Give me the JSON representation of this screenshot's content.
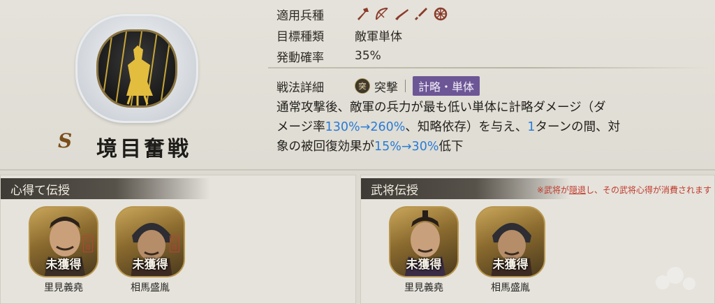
{
  "skill": {
    "rank": "S",
    "name": "境目奮戦",
    "emblem": "golden-warrior-emblem-icon"
  },
  "info": {
    "troop_label": "適用兵種",
    "troop_icons": [
      "spear-icon",
      "bow-icon",
      "gun-icon",
      "sword-icon",
      "wheel-icon"
    ],
    "target_label": "目標種類",
    "target_value": "敵軍単体",
    "rate_label": "発動確率",
    "rate_value": "35%"
  },
  "detail": {
    "label": "戦法詳細",
    "attack_icon_char": "突",
    "attack_type": "突撃",
    "tag": "計略・単体",
    "text_1": "通常攻撃後、敵軍の兵力が最も低い単体に計略ダメージ（ダ",
    "text_2a": "メージ率",
    "text_2b": "130%→260%",
    "text_2c": "、知略依存）を与え、",
    "text_2d": "1",
    "text_2e": "ターンの間、対",
    "text_3a": "象の被回復効果が",
    "text_3b": "15%→30%",
    "text_3c": "低下"
  },
  "left_panel": {
    "title": "心得て伝授",
    "cards": [
      {
        "status": "未獲得",
        "name": "里見義堯",
        "stamp": "心得"
      },
      {
        "status": "未獲得",
        "name": "相馬盛胤",
        "stamp": "心得"
      }
    ]
  },
  "right_panel": {
    "title": "武将伝授",
    "notice_a": "※武将が",
    "notice_b": "隠退",
    "notice_c": "し、その武将心得が消費されます",
    "cards": [
      {
        "status": "未獲得",
        "name": "里見義堯"
      },
      {
        "status": "未獲得",
        "name": "相馬盛胤"
      }
    ]
  }
}
